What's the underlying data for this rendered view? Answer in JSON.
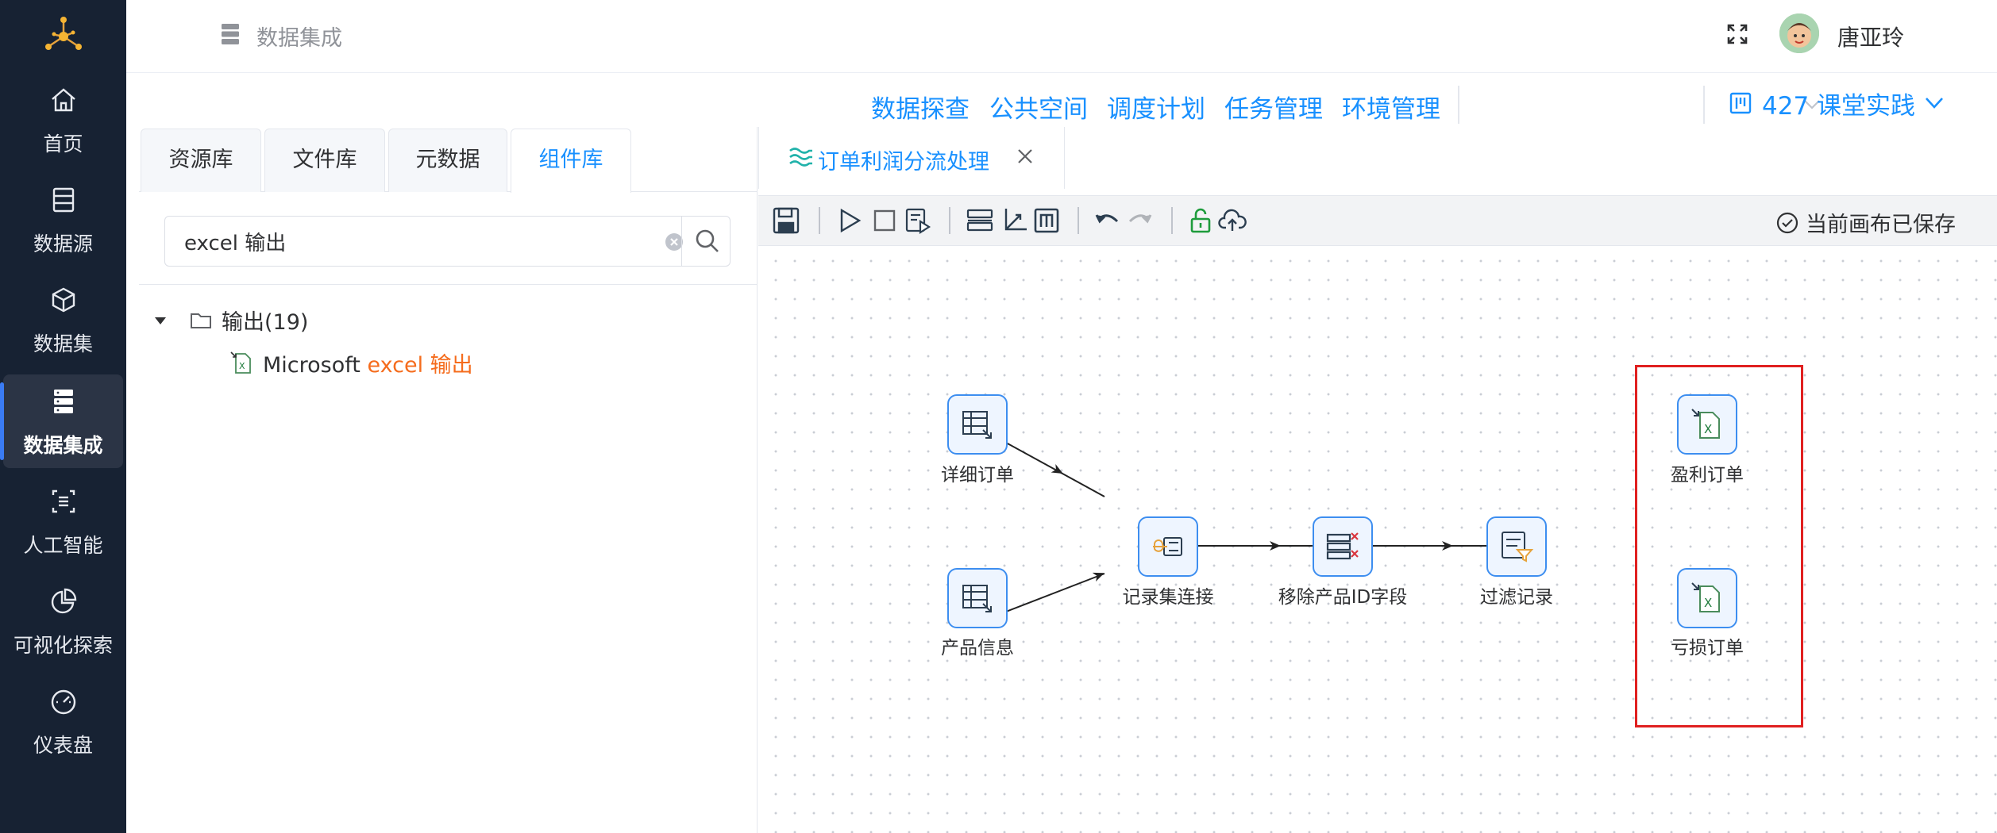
{
  "sidebar": {
    "items": [
      {
        "label": "首页",
        "icon": "home-icon"
      },
      {
        "label": "数据源",
        "icon": "database-icon"
      },
      {
        "label": "数据集",
        "icon": "cube-icon"
      },
      {
        "label": "数据集成",
        "icon": "server-icon",
        "active": true
      },
      {
        "label": "人工智能",
        "icon": "ai-icon"
      },
      {
        "label": "可视化探索",
        "icon": "pie-chart-icon"
      },
      {
        "label": "仪表盘",
        "icon": "gauge-icon"
      }
    ]
  },
  "header": {
    "breadcrumb": "数据集成",
    "user_name": "唐亚玲"
  },
  "topnav": {
    "links": [
      "数据探查",
      "公共空间",
      "调度计划",
      "任务管理",
      "环境管理"
    ],
    "project": "427 课堂实践"
  },
  "left_panel": {
    "tabs": [
      "资源库",
      "文件库",
      "元数据",
      "组件库"
    ],
    "active_tab": "组件库",
    "search": {
      "value": "excel 输出",
      "placeholder": ""
    },
    "tree": {
      "folder_label": "输出(19)",
      "item_prefix": "Microsoft ",
      "item_highlight": "excel 输出"
    }
  },
  "editor": {
    "tab_label": "订单利润分流处理",
    "saved_status": "当前画布已保存",
    "nodes": [
      {
        "label": "详细订单"
      },
      {
        "label": "产品信息"
      },
      {
        "label": "记录集连接"
      },
      {
        "label": "移除产品ID字段"
      },
      {
        "label": "过滤记录"
      },
      {
        "label": "盈利订单"
      },
      {
        "label": "亏损订单"
      }
    ]
  },
  "colors": {
    "sidebar_bg": "#172233",
    "accent": "#1890ff",
    "highlight": "#f56c1d",
    "selection_box": "#e02020"
  }
}
